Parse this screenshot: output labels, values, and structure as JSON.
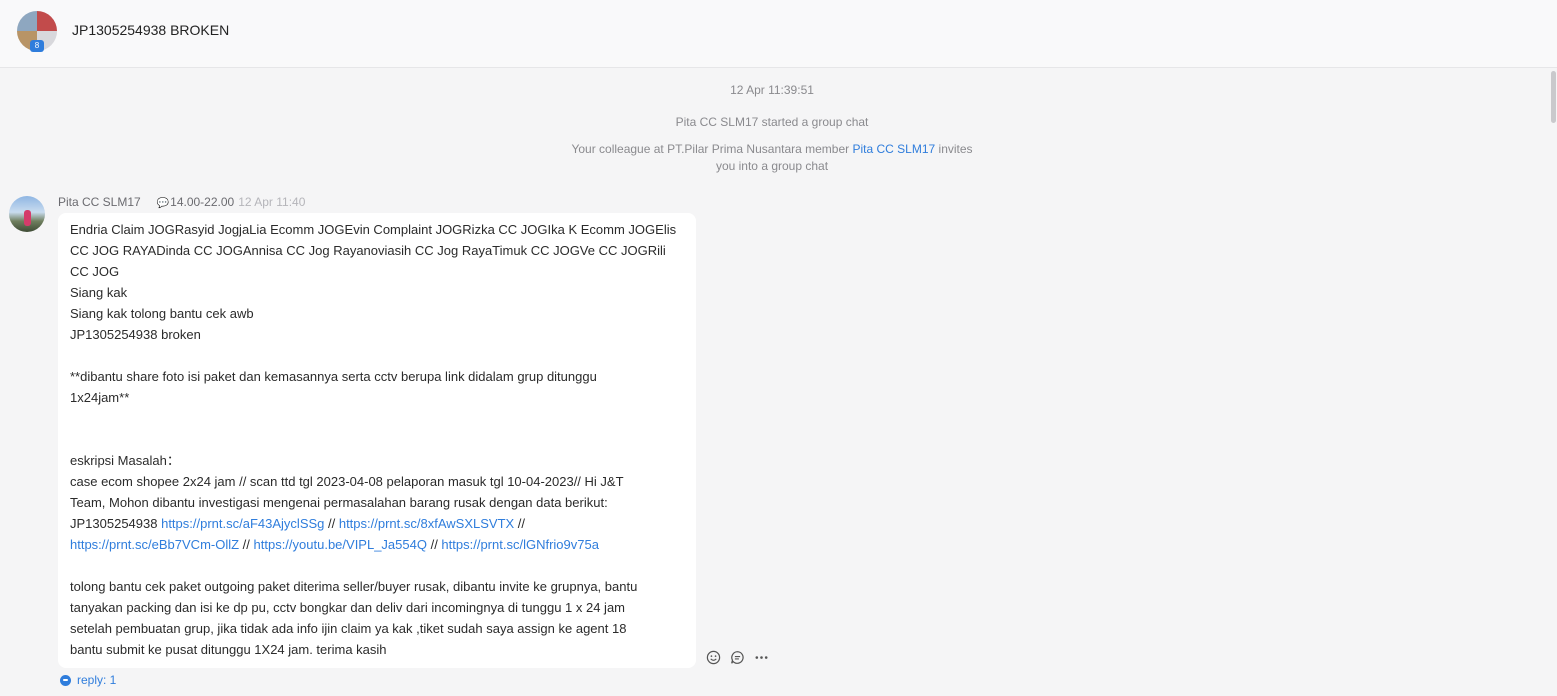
{
  "header": {
    "title": "JP1305254938 BROKEN",
    "member_count": "8"
  },
  "system": {
    "timestamp": "12 Apr 11:39:51",
    "started": "Pita CC SLM17 started a group chat",
    "invite_prefix": "Your colleague at PT.Pilar Prima Nusantara member ",
    "invite_name": "Pita CC SLM17",
    "invite_suffix": " invites",
    "invite_line2": "you into a group chat"
  },
  "message": {
    "sender": "Pita CC SLM17",
    "status": "14.00-22.00",
    "time": "12 Apr 11:40",
    "lines": [
      "Endria Claim JOGRasyid JogjaLia Ecomm JOGEvin Complaint JOGRizka CC JOGIka K Ecomm JOGElis",
      "CC JOG RAYADinda CC JOGAnnisa CC Jog Rayanoviasih CC Jog RayaTimuk CC JOGVe CC JOGRili",
      "CC JOG",
      "Siang kak",
      "Siang kak tolong bantu cek awb",
      "JP1305254938 broken",
      "**dibantu share foto isi paket dan kemasannya serta cctv berupa link didalam grup ditunggu",
      "1x24jam**",
      "eskripsi Masalah：",
      "case ecom shopee 2x24 jam // scan ttd tgl  2023-04-08 pelaporan masuk tgl 10-04-2023//  Hi J&T",
      "Team, Mohon dibantu investigasi mengenai permasalahan barang rusak dengan data berikut:",
      "JP1305254938  ",
      "tolong bantu cek paket outgoing paket diterima seller/buyer rusak, dibantu invite ke grupnya, bantu",
      "tanyakan packing dan isi ke dp pu, cctv bongkar dan deliv dari incomingnya di tunggu 1 x 24 jam",
      "setelah pembuatan grup, jika tidak ada info ijin claim ya kak ,tiket sudah saya assign ke agent 18",
      "bantu submit ke pusat ditunggu 1X24 jam. terima kasih"
    ],
    "links": [
      "https://prnt.sc/aF43AjyclSSg",
      "https://prnt.sc/8xfAwSXLSVTX",
      "https://prnt.sc/eBb7VCm-OllZ",
      "https://youtu.be/VIPL_Ja554Q",
      "https://prnt.sc/lGNfrio9v75a"
    ],
    "separator": " // ",
    "reply_label": "reply: 1"
  },
  "icons": {
    "emoji": "emoji-icon",
    "reply": "reply-bubble-icon",
    "more": "more-icon"
  }
}
